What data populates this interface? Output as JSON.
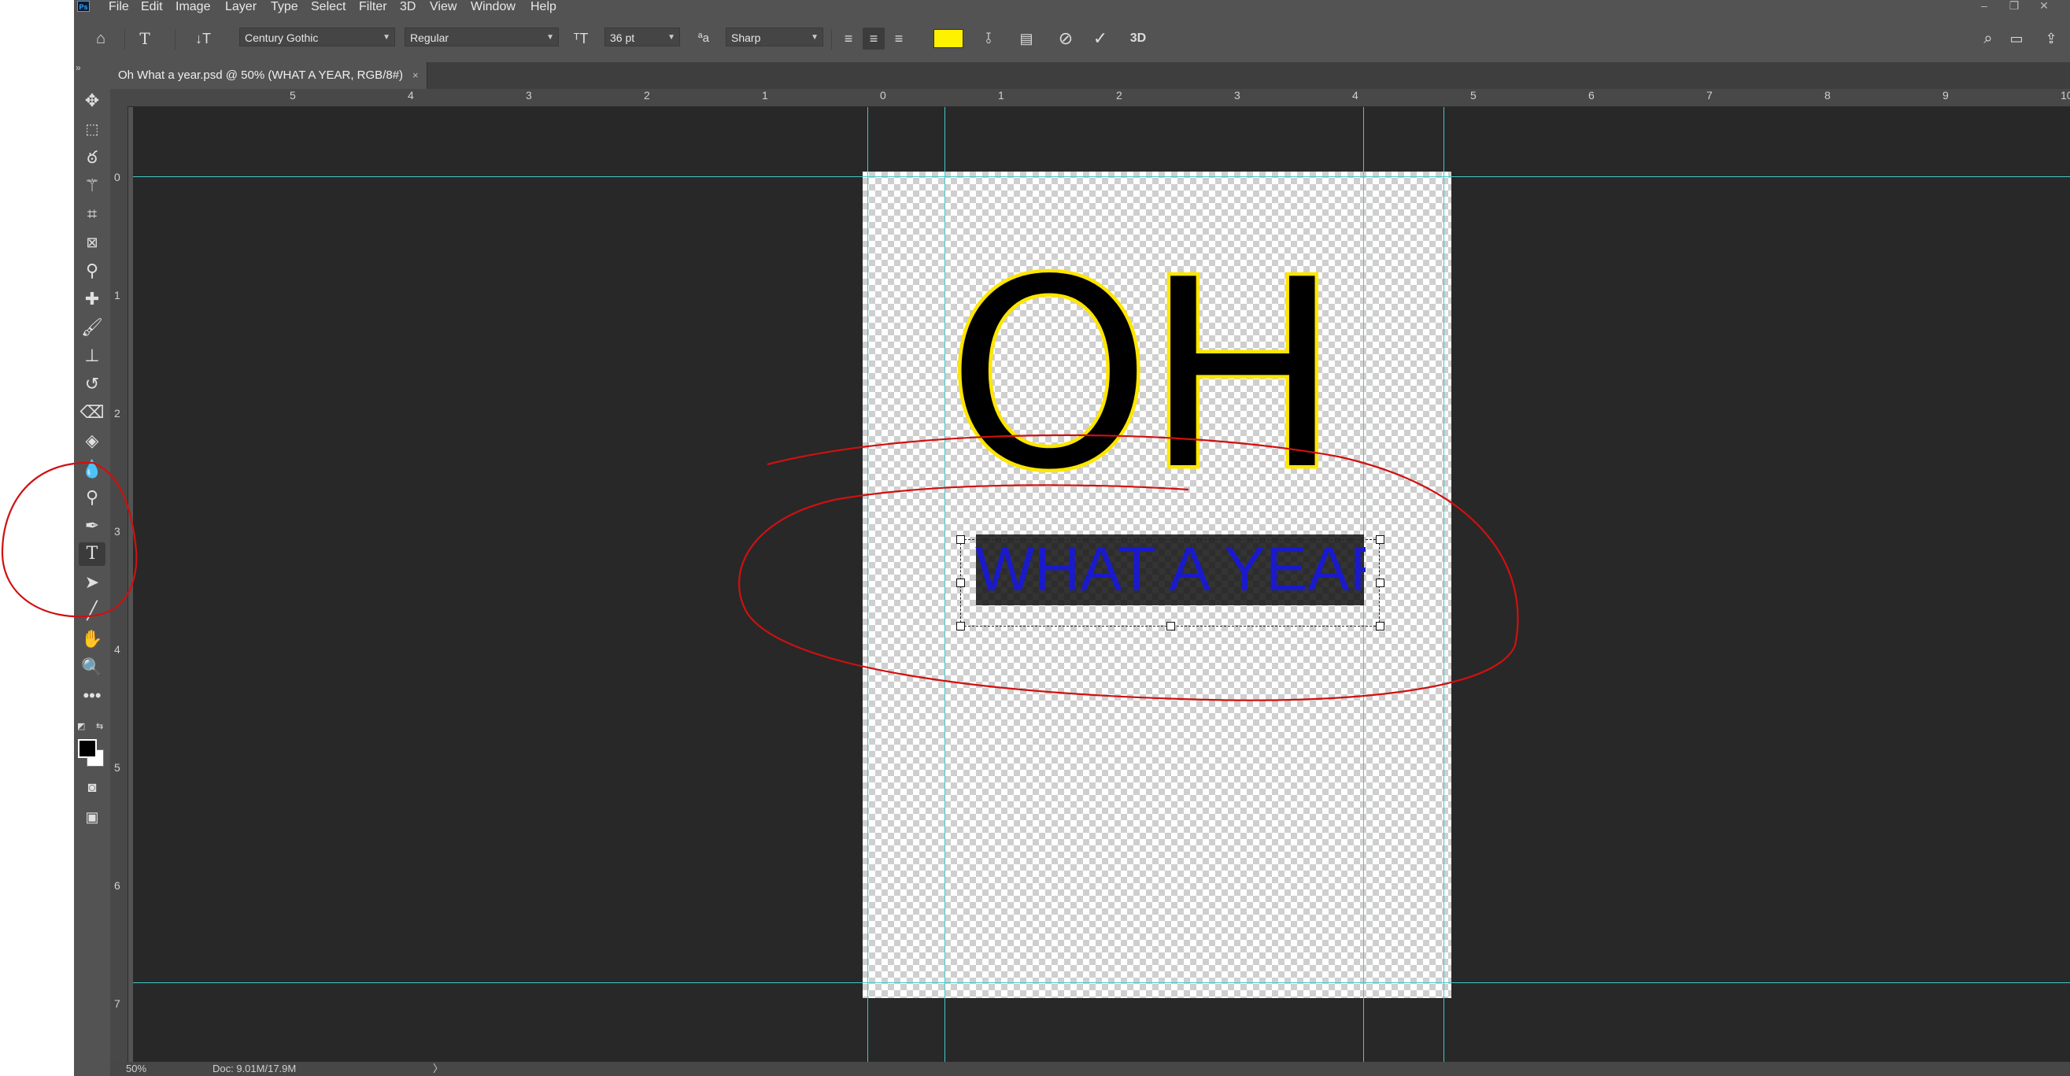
{
  "menu": {
    "logo": "Ps",
    "items": [
      "File",
      "Edit",
      "Image",
      "Layer",
      "Type",
      "Select",
      "Filter",
      "3D",
      "View",
      "Window",
      "Help"
    ]
  },
  "options_bar": {
    "font_family": "Century Gothic",
    "font_style": "Regular",
    "font_size": "36 pt",
    "antialias": "Sharp",
    "antialias_glyph": "aa",
    "text_color": "#FFF200",
    "three_d_label": "3D"
  },
  "tab": {
    "title": "Oh What a year.psd @ 50% (WHAT A YEAR, RGB/8#)",
    "close": "×"
  },
  "rulers": {
    "horizontal": [
      "5",
      "4",
      "3",
      "2",
      "1",
      "0",
      "1",
      "2",
      "3",
      "4",
      "5",
      "6",
      "7",
      "8",
      "9",
      "10"
    ],
    "vertical": [
      "0",
      "1",
      "2",
      "3",
      "4",
      "5",
      "6",
      "7"
    ]
  },
  "canvas": {
    "title_text": "OH",
    "subtitle_text": "WHAT A YEAR",
    "title_fill": "#000000",
    "title_stroke": "#FFE600",
    "subtitle_color": "#1A1ACC",
    "guide_color": "#44C8C8",
    "annotation_color": "#D01010"
  },
  "status": {
    "zoom": "50%",
    "doc": "Doc: 9.01M/17.9M",
    "arrow": "〉"
  },
  "tools": [
    "move-tool-icon",
    "marquee-tool-icon",
    "lasso-tool-icon",
    "magic-wand-icon",
    "crop-tool-icon",
    "frame-tool-icon",
    "eyedropper-icon",
    "healing-brush-icon",
    "brush-tool-icon",
    "clone-stamp-icon",
    "history-brush-icon",
    "eraser-icon",
    "paint-bucket-icon",
    "blur-tool-icon",
    "dodge-tool-icon",
    "pen-tool-icon",
    "type-tool-icon",
    "path-selection-icon",
    "line-tool-icon",
    "hand-tool-icon",
    "zoom-tool-icon",
    "more-tools-icon"
  ]
}
